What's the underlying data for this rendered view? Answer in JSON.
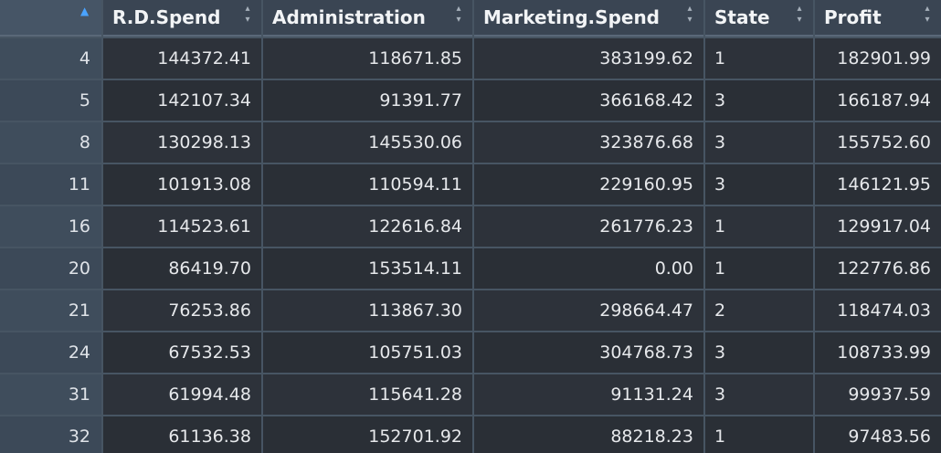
{
  "table": {
    "columns": [
      {
        "key": "R.D.Spend",
        "label": "R.D.Spend"
      },
      {
        "key": "Administration",
        "label": "Administration"
      },
      {
        "key": "Marketing.Spend",
        "label": "Marketing.Spend"
      },
      {
        "key": "State",
        "label": "State"
      },
      {
        "key": "Profit",
        "label": "Profit"
      }
    ],
    "sort": {
      "column": "row-index",
      "direction": "ascending"
    },
    "rows": [
      {
        "id": "4",
        "cells": [
          "144372.41",
          "118671.85",
          "383199.62",
          "1",
          "182901.99"
        ]
      },
      {
        "id": "5",
        "cells": [
          "142107.34",
          "91391.77",
          "366168.42",
          "3",
          "166187.94"
        ]
      },
      {
        "id": "8",
        "cells": [
          "130298.13",
          "145530.06",
          "323876.68",
          "3",
          "155752.60"
        ]
      },
      {
        "id": "11",
        "cells": [
          "101913.08",
          "110594.11",
          "229160.95",
          "3",
          "146121.95"
        ]
      },
      {
        "id": "16",
        "cells": [
          "114523.61",
          "122616.84",
          "261776.23",
          "1",
          "129917.04"
        ]
      },
      {
        "id": "20",
        "cells": [
          "86419.70",
          "153514.11",
          "0.00",
          "1",
          "122776.86"
        ]
      },
      {
        "id": "21",
        "cells": [
          "76253.86",
          "113867.30",
          "298664.47",
          "2",
          "118474.03"
        ]
      },
      {
        "id": "24",
        "cells": [
          "67532.53",
          "105751.03",
          "304768.73",
          "3",
          "108733.99"
        ]
      },
      {
        "id": "31",
        "cells": [
          "61994.48",
          "115641.28",
          "91131.24",
          "3",
          "99937.59"
        ]
      },
      {
        "id": "32",
        "cells": [
          "61136.38",
          "152701.92",
          "88218.23",
          "1",
          "97483.56"
        ]
      }
    ]
  },
  "icons": {
    "sort_ascending": "triangle-up",
    "sortable": "up-down-arrows"
  },
  "colors": {
    "header_bg": "#3a4553",
    "row_bg": "#2d323a",
    "rowhdr_bg": "#3f4d5c",
    "sort_accent": "#4aa3ff"
  }
}
